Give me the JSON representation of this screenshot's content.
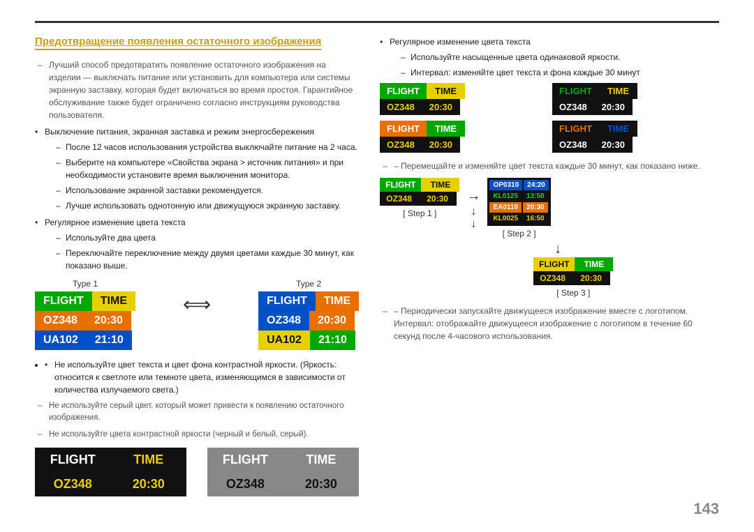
{
  "page": {
    "page_number": "143",
    "top_line_color": "#333"
  },
  "section_title": "Предотвращение появления остаточного изображения",
  "intro_text": "Лучший способ предотвратить появление остаточного изображения на изделии — выключать питание или установить для компьютера или системы экранную заставку, которая будет включаться во время простоя. Гарантийное обслуживание также будет ограничено согласно инструкциям руководства пользователя.",
  "bullets": [
    {
      "text": "Выключение питания, экранная заставка и режим энергосбережения",
      "sub": [
        "После 12 часов использования устройства выключайте питание на 2 часа.",
        "Выберите на компьютере «Свойства экрана > источник питания» и при необходимости установите время выключения монитора.",
        "Использование экранной заставки рекомендуется.",
        "Лучше использовать однотонную или движущуюся экранную заставку."
      ]
    },
    {
      "text": "Регулярное изменение цвета текста",
      "sub": [
        "Используйте два цвета",
        "Переключайте переключение между двумя цветами каждые 30 минут, как показано выше."
      ]
    }
  ],
  "type_labels": [
    "Type 1",
    "Type 2"
  ],
  "type1": {
    "header": [
      "FLIGHT",
      "TIME"
    ],
    "header_colors": [
      "#00a800",
      "#e8d000"
    ],
    "rows": [
      {
        "left": "OZ348",
        "right": "20:30",
        "left_bg": "#e87000",
        "right_bg": "#e87000"
      },
      {
        "left": "UA102",
        "right": "21:10",
        "left_bg": "#0050c8",
        "right_bg": "#0050c8"
      }
    ]
  },
  "type2": {
    "header": [
      "FLIGHT",
      "TIME"
    ],
    "header_colors": [
      "#0050c8",
      "#e87000"
    ],
    "rows": [
      {
        "left": "OZ348",
        "right": "20:30",
        "left_bg": "#0050c8",
        "right_bg": "#e87000"
      },
      {
        "left": "UA102",
        "right": "21:10",
        "left_bg": "#e8d000",
        "right_bg": "#00a800"
      }
    ]
  },
  "right_section": {
    "bullet_texts": [
      "Регулярное изменение цвета текста"
    ],
    "sub_texts": [
      "Используйте насыщенные цвета одинаковой яркости.",
      "Интервал: изменяйте цвет текста и фона каждые 30 минут"
    ],
    "panels": [
      {
        "header_bg1": "#00a800",
        "header_bg2": "#e8d000",
        "row_bg1": "#111",
        "row_bg2": "#111",
        "header_txt": "#fff",
        "row_txt": "#e8d000"
      },
      {
        "header_bg1": "#111",
        "header_bg2": "#111",
        "row_bg1": "#111",
        "row_bg2": "#111",
        "header_txt_1": "#00a800",
        "header_txt_2": "#e8d000",
        "row_txt": "#fff"
      },
      {
        "header_bg1": "#e87000",
        "header_bg2": "#00a800",
        "row_bg1": "#111",
        "row_bg2": "#111",
        "header_txt": "#fff",
        "row_txt": "#e8d000"
      },
      {
        "header_bg1": "#111",
        "header_bg2": "#111",
        "row_bg1": "#111",
        "row_bg2": "#111",
        "header_txt_1": "#e87000",
        "header_txt_2": "#0050c8",
        "row_txt": "#fff"
      }
    ],
    "step_note": "– Перемещайте и изменяйте цвет текста каждые 30 минут, как показано ниже.",
    "step_labels": [
      "[ Step 1 ]",
      "[ Step 2 ]",
      "[ Step 3 ]"
    ],
    "periodic_note": "– Периодически запускайте движущееся изображение вместе с логотипом.\nИнтервал: отображайте движущееся изображение с логотипом в течение 60 секунд после 4-часового использования."
  },
  "bottom_section": {
    "dash_notes": [
      "Не используйте цвет текста и цвет фона контрастной яркости.\n(Яркость: относится к светлоте или темноте цвета, изменяющимся в зависимости от\nколичества излучаемого света.)",
      "Не используйте серый цвет, который может привести к появлению остаточного\nизображения.",
      "Не используйте цвета контрастной яркости (черный и белый, серый)."
    ],
    "panel_black": {
      "header": [
        "FLIGHT",
        "TIME"
      ],
      "row": [
        "OZ348",
        "20:30"
      ],
      "header_colors": [
        "#111",
        "#111"
      ],
      "header_txt_colors": [
        "#fff",
        "#e8d000"
      ],
      "row_bg": "#111",
      "row_txt": "#e8d000"
    },
    "panel_gray": {
      "header": [
        "FLIGHT",
        "TIME"
      ],
      "row": [
        "OZ348",
        "20:30"
      ],
      "header_colors": [
        "#888",
        "#888"
      ],
      "header_txt_colors": [
        "#fff",
        "#fff"
      ],
      "row_bg": "#888",
      "row_txt": "#111"
    }
  },
  "labels": {
    "flight": "FLIGHT",
    "time": "TIME",
    "oz348": "OZ348",
    "time_val": "20:30",
    "ua102": "UA102",
    "time_val2": "21:10",
    "colon": ":",
    "step2_rows": [
      [
        "OP0310",
        "24:20"
      ],
      [
        "KL0125",
        "13:50"
      ],
      [
        "EA0110",
        "20:30"
      ],
      [
        "KL0025",
        "16:50"
      ]
    ]
  }
}
